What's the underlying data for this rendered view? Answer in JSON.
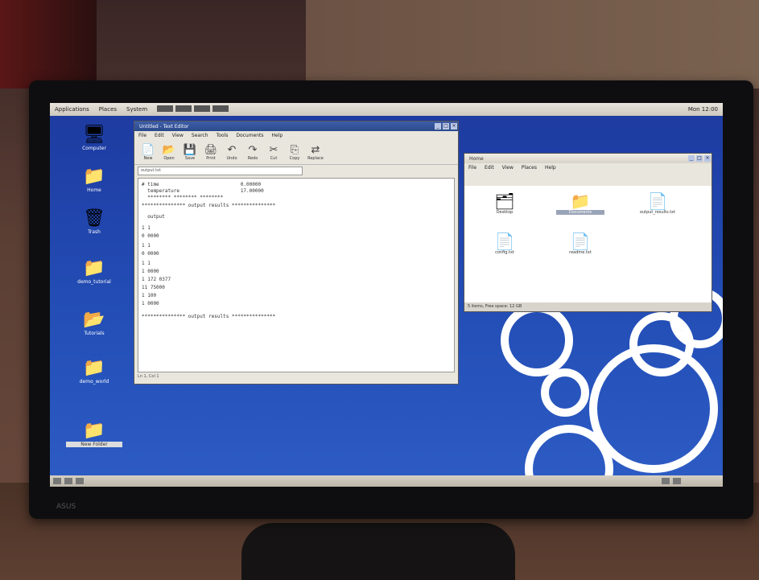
{
  "desktop": {
    "top_panel": {
      "menus": [
        "Applications",
        "Places",
        "System"
      ],
      "clock": "Mon 12:00"
    },
    "icons": [
      {
        "label": "Computer",
        "icon": "computer-icon",
        "glyph": "🖥"
      },
      {
        "label": "Home",
        "icon": "folder-home-icon",
        "glyph": "📁"
      },
      {
        "label": "Trash",
        "icon": "trash-icon",
        "glyph": "🗑"
      },
      {
        "label": "demo_tutorial",
        "icon": "folder-icon",
        "glyph": "📁"
      },
      {
        "label": "Tutorials",
        "icon": "folder-icon",
        "glyph": "📂"
      },
      {
        "label": "demo_world",
        "icon": "folder-icon",
        "glyph": "📁"
      },
      {
        "label": "New Folder",
        "icon": "folder-icon",
        "glyph": "📁"
      }
    ]
  },
  "editor_window": {
    "title": "Untitled - Text Editor",
    "menus": [
      "File",
      "Edit",
      "View",
      "Search",
      "Tools",
      "Documents",
      "Help"
    ],
    "toolbar": [
      {
        "label": "New",
        "glyph": "📄"
      },
      {
        "label": "Open",
        "glyph": "📂"
      },
      {
        "label": "Save",
        "glyph": "💾"
      },
      {
        "label": "Print",
        "glyph": "🖨"
      },
      {
        "label": "Undo",
        "glyph": "↶"
      },
      {
        "label": "Redo",
        "glyph": "↷"
      },
      {
        "label": "Cut",
        "glyph": "✂"
      },
      {
        "label": "Copy",
        "glyph": "⎘"
      },
      {
        "label": "Replace",
        "glyph": "⇄"
      }
    ],
    "tab": "output.txt",
    "lines": [
      "# time                            0.00000",
      "  temperature                     17.00000",
      "  ******** ******** ********",
      "*************** output results ***************",
      "  output",
      "1 1",
      "0 0000",
      "1 1",
      "0 0000",
      "1 1",
      "1 0000",
      "1 172 0377",
      "11 75000",
      "1 100",
      "1 0000",
      "*************** output results ***************"
    ],
    "status": "Ln 1, Col 1"
  },
  "file_window": {
    "title": "Home",
    "menus": [
      "File",
      "Edit",
      "View",
      "Places",
      "Help"
    ],
    "items": [
      {
        "label": "Desktop",
        "icon": "folder-icon",
        "glyph": "🗂"
      },
      {
        "label": "Documents",
        "icon": "folder-icon",
        "glyph": "📁"
      },
      {
        "label": "output_results.txt",
        "icon": "text-file-icon",
        "glyph": "📄"
      },
      {
        "label": "config.txt",
        "icon": "text-file-icon",
        "glyph": "📄"
      },
      {
        "label": "readme.txt",
        "icon": "text-file-icon",
        "glyph": "📄"
      }
    ],
    "status": "5 items, Free space: 12 GB"
  }
}
